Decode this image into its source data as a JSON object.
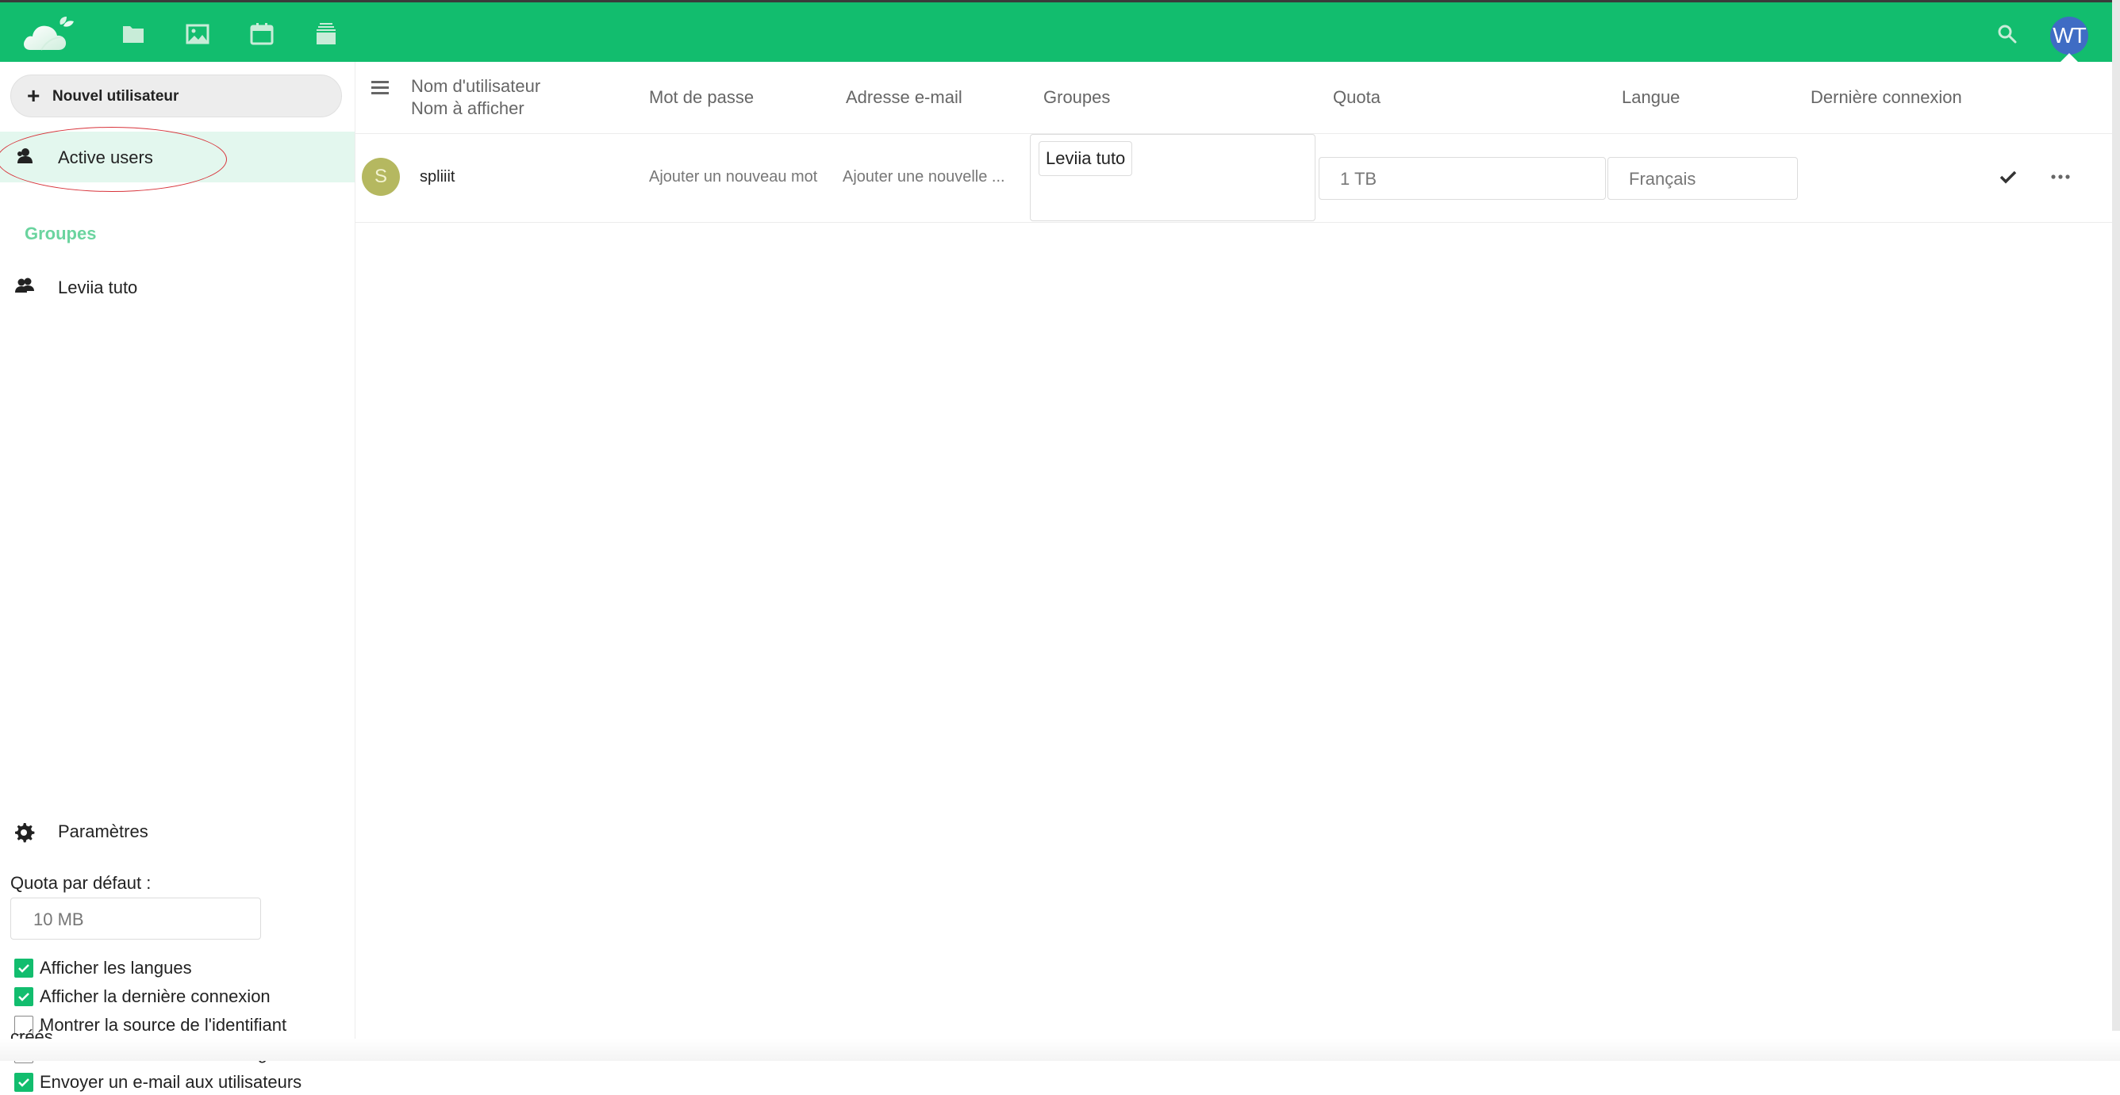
{
  "topbar": {
    "logo": "nextcloud-cloud-leaf-logo",
    "apps": [
      {
        "name": "files",
        "icon": "folder-icon"
      },
      {
        "name": "photos",
        "icon": "image-icon"
      },
      {
        "name": "calendar",
        "icon": "calendar-icon"
      },
      {
        "name": "deck",
        "icon": "stack-icon"
      }
    ],
    "search_icon": "search-icon",
    "user_avatar_initials": "WT",
    "accent_color": "#12bd6e",
    "avatar_color": "#3f6cc4"
  },
  "sidebar": {
    "new_user_label": "Nouvel utilisateur",
    "active_users_label": "Active users",
    "groups_caption": "Groupes",
    "groups": [
      {
        "label": "Leviia tuto"
      }
    ],
    "settings_label": "Paramètres",
    "default_quota_label": "Quota par défaut :",
    "default_quota_value": "10 MB",
    "options": [
      {
        "label": "Afficher les langues",
        "checked": true
      },
      {
        "label": "Afficher la dernière connexion",
        "checked": true
      },
      {
        "label": "Montrer la source de l'identifiant",
        "checked": false
      },
      {
        "label": "Afficher le chemin du stockage",
        "checked": false
      },
      {
        "label": "Envoyer un e-mail aux utilisateurs",
        "checked": true
      }
    ],
    "options_wrap_text": "créés"
  },
  "table": {
    "headers": {
      "username": "Nom d'utilisateur",
      "display_name": "Nom à afficher",
      "password": "Mot de passe",
      "email": "Adresse e-mail",
      "groups": "Groupes",
      "quota": "Quota",
      "language": "Langue",
      "last_login": "Dernière connexion"
    },
    "rows": [
      {
        "avatar_initial": "S",
        "avatar_color": "#b5b860",
        "username": "spliiit",
        "password_placeholder": "Ajouter un nouveau mot",
        "email_placeholder": "Ajouter une nouvelle ...",
        "groups": [
          "Leviia tuto"
        ],
        "quota": "1 TB",
        "language": "Français",
        "last_login": ""
      }
    ]
  }
}
